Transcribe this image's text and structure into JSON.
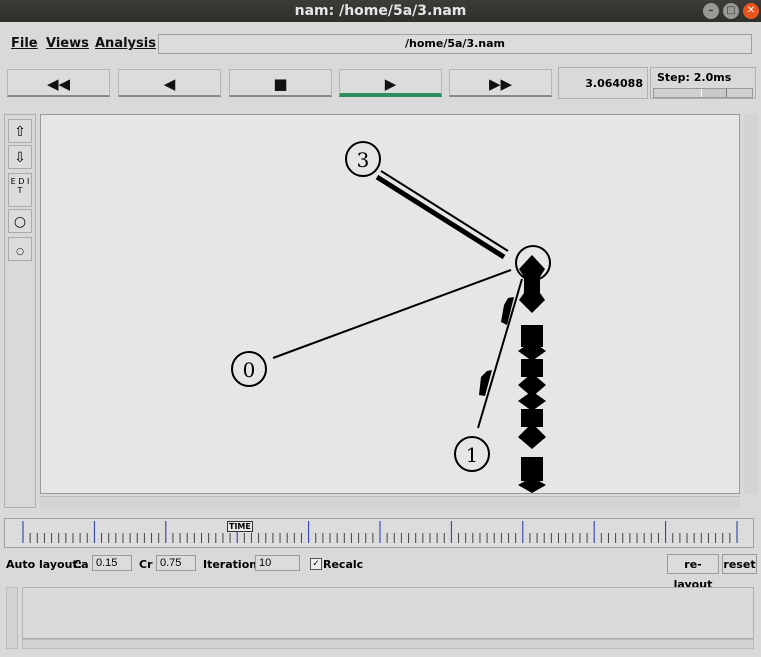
{
  "window": {
    "title": "nam: /home/5a/3.nam"
  },
  "menu": {
    "file": "File",
    "views": "Views",
    "analysis": "Analysis"
  },
  "file_path": "/home/5a/3.nam",
  "controls": {
    "rewind_icon": "◀◀",
    "back_icon": "◀",
    "stop_icon": "■",
    "play_icon": "▶",
    "ffwd_icon": "▶▶",
    "time": "3.064088",
    "step_label": "Step: 2.0ms",
    "step_level": 0.65
  },
  "tools": {
    "edit_label": "E D I T"
  },
  "network": {
    "nodes": [
      {
        "id": "3",
        "label": "3"
      },
      {
        "id": "2",
        "label": ""
      },
      {
        "id": "0",
        "label": "0"
      },
      {
        "id": "1",
        "label": "1"
      }
    ],
    "links": [
      {
        "from": "3",
        "to": "2",
        "style": "duplex"
      },
      {
        "from": "0",
        "to": "2",
        "style": "line"
      },
      {
        "from": "1",
        "to": "2",
        "style": "line"
      }
    ]
  },
  "timeline": {
    "label": "TIME"
  },
  "auto_layout": {
    "label": "Auto layout:",
    "ca_label": "Ca",
    "ca_value": "0.15",
    "cr_label": "Cr",
    "cr_value": "0.75",
    "iterations_label": "Iterations",
    "iterations_value": "10",
    "recalc_label": "Recalc",
    "recalc_checked": true,
    "relayout_label": "re-layout",
    "reset_label": "reset"
  }
}
